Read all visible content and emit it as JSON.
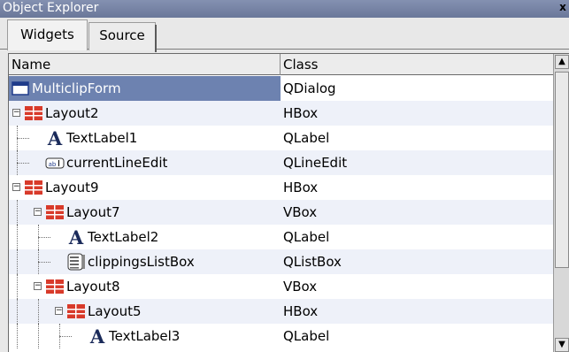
{
  "window": {
    "title": "Object Explorer",
    "close_glyph": "x"
  },
  "tabs": [
    {
      "label": "Widgets",
      "active": true
    },
    {
      "label": "Source",
      "active": false
    }
  ],
  "columns": {
    "name": "Name",
    "class": "Class"
  },
  "rows": [
    {
      "name": "MulticlipForm",
      "class": "QDialog",
      "icon": "dialog-icon",
      "selected": true
    },
    {
      "name": "Layout2",
      "class": "HBox",
      "icon": "layout-icon",
      "expanded": true
    },
    {
      "name": "TextLabel1",
      "class": "QLabel",
      "icon": "text-label-icon"
    },
    {
      "name": "currentLineEdit",
      "class": "QLineEdit",
      "icon": "line-edit-icon"
    },
    {
      "name": "Layout9",
      "class": "HBox",
      "icon": "layout-icon",
      "expanded": true
    },
    {
      "name": "Layout7",
      "class": "VBox",
      "icon": "layout-icon",
      "expanded": true
    },
    {
      "name": "TextLabel2",
      "class": "QLabel",
      "icon": "text-label-icon"
    },
    {
      "name": "clippingsListBox",
      "class": "QListBox",
      "icon": "list-box-icon"
    },
    {
      "name": "Layout8",
      "class": "VBox",
      "icon": "layout-icon",
      "expanded": true
    },
    {
      "name": "Layout5",
      "class": "HBox",
      "icon": "layout-icon",
      "expanded": true
    },
    {
      "name": "TextLabel3",
      "class": "QLabel",
      "icon": "text-label-icon"
    }
  ],
  "colors": {
    "selection": "#6d82b0",
    "titlebar": "#7583a6",
    "row_alt": "#eef1f9",
    "layout_icon": "#d83a2a"
  }
}
